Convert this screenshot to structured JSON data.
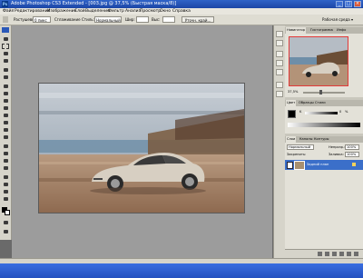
{
  "window": {
    "title": "Adobe Photoshop CS3 Extended - [003.jpg @ 37,5% (Быстрая маска/8)]",
    "logo": "Ps",
    "minimize": "_",
    "maximize": "□",
    "close": "×"
  },
  "menu": [
    "Файл",
    "Редактирование",
    "Изображение",
    "Слой",
    "Выделение",
    "Фильтр",
    "Анализ",
    "Просмотр",
    "Окно",
    "Справка"
  ],
  "options": {
    "feather_label": "Растушевка:",
    "feather_value": "0 пикс",
    "antialias_label": "Сглаживание",
    "style_label": "Стиль:",
    "style_value": "Нормальный",
    "width_label": "Шир:",
    "height_label": "Выс:",
    "refine_label": "Уточн. край...",
    "workspace_label": "Рабочая среда ▾"
  },
  "panels": {
    "navigator_tabs": [
      "Навигатор",
      "Гистограмма",
      "Инфо"
    ],
    "navigator_zoom": "37,5%",
    "color_tabs": [
      "Цвет",
      "Образцы",
      "Стили"
    ],
    "color_label": "K",
    "color_value": "0",
    "color_unit": "%",
    "layers_tabs": [
      "Слои",
      "Каналы",
      "Контуры"
    ],
    "blend_mode": "Нормальный",
    "opacity_label": "Непрозр.:",
    "opacity_value": "100%",
    "lock_label": "Закрепить:",
    "fill_label": "Заливка:",
    "fill_value": "100%",
    "layer_name": "Задний план"
  },
  "colors": {
    "titlebar": "#2f63c8",
    "panel_bg": "#e3e1d8",
    "navigator_frame": "#e23a3a",
    "canvas_bg": "#9c9c9c"
  }
}
